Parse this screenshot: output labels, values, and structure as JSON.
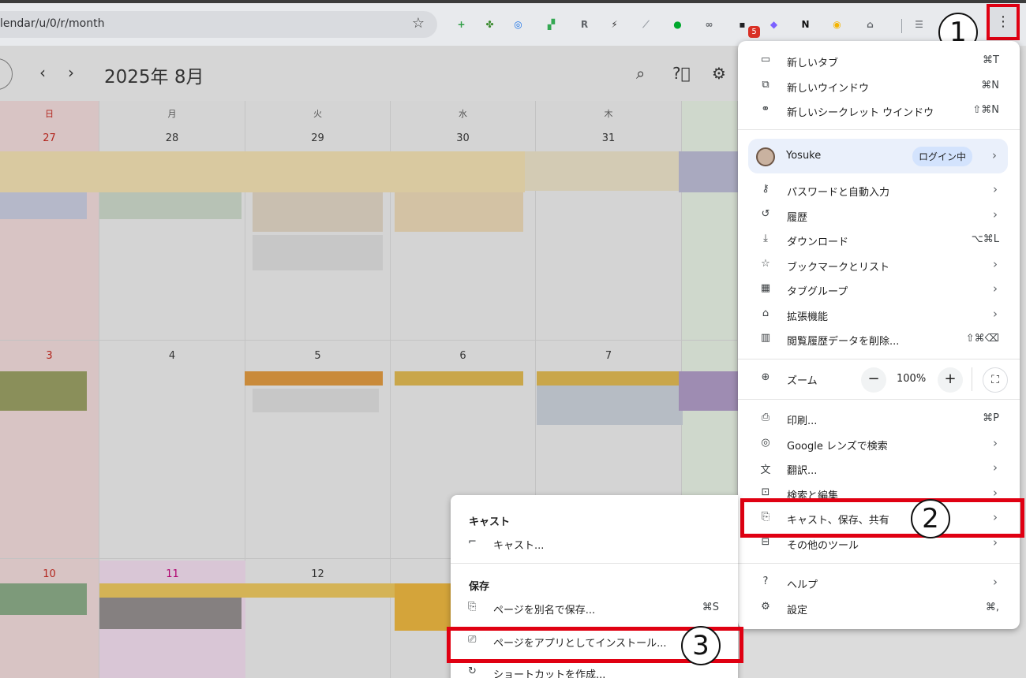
{
  "browser": {
    "url": "lendar/u/0/r/month",
    "extension_badge": "5",
    "callouts": [
      "1",
      "2",
      "3"
    ],
    "extensions": [
      {
        "icon": "plus-circle-icon",
        "glyph": "+",
        "color": "#2e9e44"
      },
      {
        "icon": "clover-icon",
        "glyph": "✤",
        "color": "#3a8a2e"
      },
      {
        "icon": "compass-icon",
        "glyph": "◎",
        "color": "#1a73e8"
      },
      {
        "icon": "google-tile-icon",
        "glyph": "▞",
        "color": "#34a853"
      },
      {
        "icon": "r-icon",
        "glyph": "R",
        "color": "#5f6368"
      },
      {
        "icon": "bolt-icon",
        "glyph": "⚡",
        "color": "#333333"
      },
      {
        "icon": "graph-icon",
        "glyph": "⟋",
        "color": "#9aa0a6"
      },
      {
        "icon": "evernote-icon",
        "glyph": "●",
        "color": "#00a82d"
      },
      {
        "icon": "binoculars-icon",
        "glyph": "∞",
        "color": "#5f6368"
      },
      {
        "icon": "chat-icon",
        "glyph": "▪",
        "color": "#202124"
      },
      {
        "icon": "purple-gem-icon",
        "glyph": "◆",
        "color": "#7b61ff"
      },
      {
        "icon": "notion-icon",
        "glyph": "N",
        "color": "#111111"
      },
      {
        "icon": "bulb-icon",
        "glyph": "◉",
        "color": "#f4b400"
      },
      {
        "icon": "puzzle-icon",
        "glyph": "⌂",
        "color": "#5f6368"
      },
      {
        "icon": "reading-list-icon",
        "glyph": "☰",
        "color": "#5f6368"
      }
    ]
  },
  "calendar": {
    "title": "2025年 8月",
    "days": [
      "日",
      "月",
      "火",
      "水",
      "木"
    ],
    "week1": [
      "27",
      "28",
      "29",
      "30",
      "31"
    ],
    "week2": [
      "3",
      "4",
      "5",
      "6",
      "7"
    ],
    "week3": [
      "10",
      "11",
      "12"
    ]
  },
  "menu": {
    "items1": [
      {
        "icon": "new-tab-icon",
        "glyph": "▭",
        "label": "新しいタブ",
        "shortcut": "⌘T"
      },
      {
        "icon": "new-window-icon",
        "glyph": "⧉",
        "label": "新しいウインドウ",
        "shortcut": "⌘N"
      },
      {
        "icon": "incognito-icon",
        "glyph": "⚭",
        "label": "新しいシークレット ウインドウ",
        "shortcut": "⇧⌘N"
      }
    ],
    "profile": {
      "name": "Yosuke",
      "status": "ログイン中"
    },
    "items2": [
      {
        "icon": "key-icon",
        "glyph": "⚷",
        "label": "パスワードと自動入力",
        "shortcut": ""
      },
      {
        "icon": "history-icon",
        "glyph": "↺",
        "label": "履歴",
        "shortcut": ""
      },
      {
        "icon": "download-icon",
        "glyph": "⤓",
        "label": "ダウンロード",
        "shortcut": "⌥⌘L"
      },
      {
        "icon": "star-icon",
        "glyph": "☆",
        "label": "ブックマークとリスト",
        "shortcut": ""
      },
      {
        "icon": "tab-groups-icon",
        "glyph": "▦",
        "label": "タブグループ",
        "shortcut": ""
      },
      {
        "icon": "puzzle-icon",
        "glyph": "⌂",
        "label": "拡張機能",
        "shortcut": ""
      },
      {
        "icon": "trash-icon",
        "glyph": "▥",
        "label": "閲覧履歴データを削除...",
        "shortcut": "⇧⌘⌫"
      }
    ],
    "zoom": {
      "label": "ズーム",
      "value": "100%",
      "minus": "−",
      "plus": "+",
      "icon_glyph": "⊕",
      "fullscreen_glyph": "⛶"
    },
    "items3": [
      {
        "icon": "print-icon",
        "glyph": "⎙",
        "label": "印刷...",
        "shortcut": "⌘P"
      },
      {
        "icon": "lens-icon",
        "glyph": "◎",
        "label": "Google レンズで検索",
        "shortcut": ""
      },
      {
        "icon": "translate-icon",
        "glyph": "文",
        "label": "翻訳...",
        "shortcut": ""
      },
      {
        "icon": "search-edit-icon",
        "glyph": "⊡",
        "label": "検索と編集",
        "shortcut": ""
      },
      {
        "icon": "cast-save-icon",
        "glyph": "⎘",
        "label": "キャスト、保存、共有",
        "shortcut": ""
      },
      {
        "icon": "toolbox-icon",
        "glyph": "⊟",
        "label": "その他のツール",
        "shortcut": ""
      }
    ],
    "items4": [
      {
        "icon": "help-icon",
        "glyph": "?",
        "label": "ヘルプ",
        "shortcut": ""
      },
      {
        "icon": "settings-icon",
        "glyph": "⚙",
        "label": "設定",
        "shortcut": "⌘,"
      }
    ]
  },
  "submenu": {
    "cast_header": "キャスト",
    "cast_item": {
      "glyph": "⌐",
      "label": "キャスト..."
    },
    "save_header": "保存",
    "save_items": [
      {
        "glyph": "⎘",
        "label": "ページを別名で保存...",
        "shortcut": "⌘S"
      },
      {
        "glyph": "⎚",
        "label": "ページをアプリとしてインストール...",
        "shortcut": ""
      },
      {
        "glyph": "↻",
        "label": "ショートカットを作成...",
        "shortcut": ""
      }
    ]
  }
}
